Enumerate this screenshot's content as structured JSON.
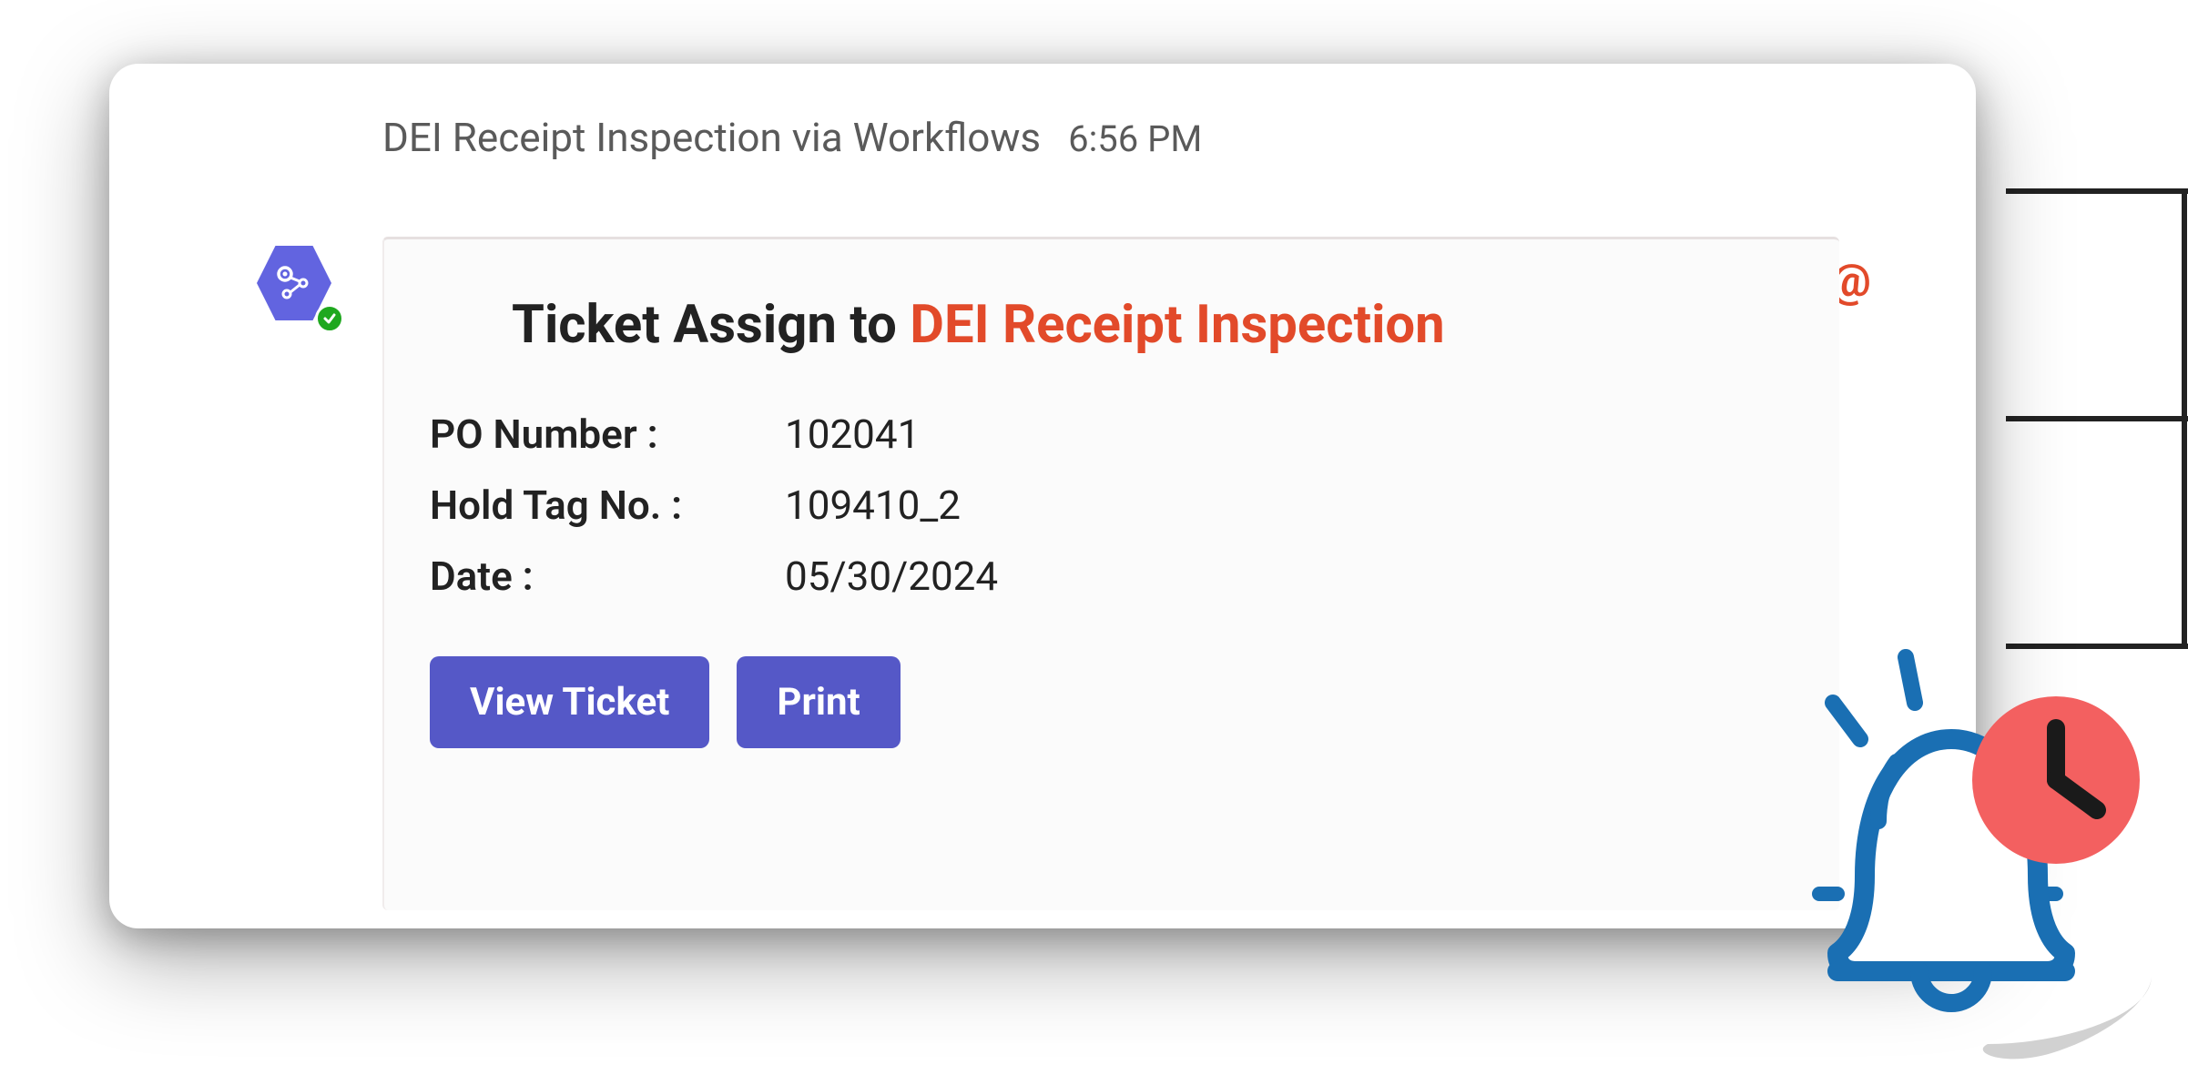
{
  "header": {
    "title": "DEI Receipt Inspection via Workflows",
    "time": "6:56 PM"
  },
  "card": {
    "title_prefix": "Ticket Assign to ",
    "title_highlight": "DEI Receipt Inspection",
    "fields": {
      "po_number_label": "PO Number :",
      "po_number_value": "102041",
      "hold_tag_label": "Hold Tag No. :",
      "hold_tag_value": "109410_2",
      "date_label": "Date :",
      "date_value": "05/30/2024"
    },
    "buttons": {
      "view_ticket": "View Ticket",
      "print": "Print"
    }
  },
  "icons": {
    "app": "share-workflow-icon",
    "badge": "check-badge",
    "at": "@",
    "bell": "bell-clock-notification"
  },
  "colors": {
    "accent": "#5558c7",
    "highlight": "#e24a2a",
    "bell_stroke": "#1a6fb3",
    "clock_fill": "#f36060"
  }
}
